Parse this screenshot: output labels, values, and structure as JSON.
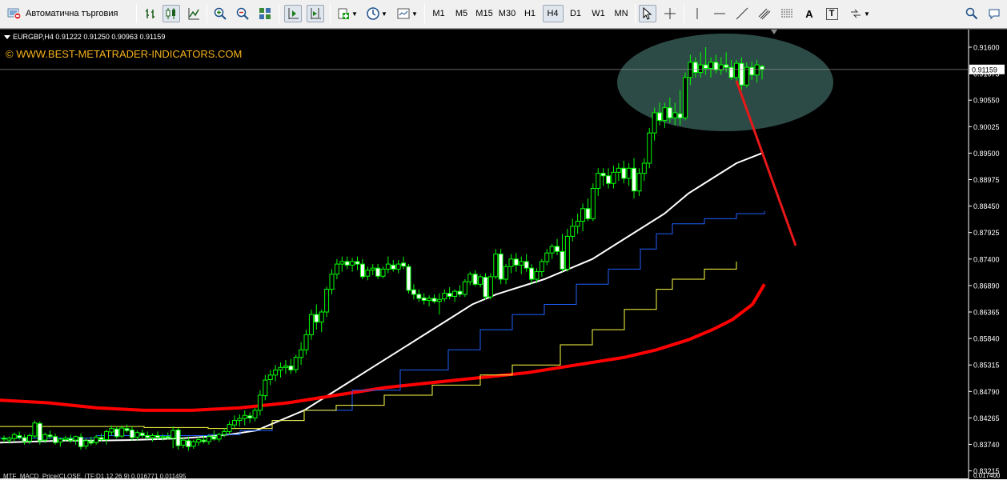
{
  "toolbar": {
    "autotrading_label": "Автоматична търговия",
    "timeframes": [
      "M1",
      "M5",
      "M15",
      "M30",
      "H1",
      "H4",
      "D1",
      "W1",
      "MN"
    ],
    "active_timeframe": "H4",
    "letter_tool": "A",
    "text_tool": "T"
  },
  "chart": {
    "symbol_info": "EURGBP,H4  0.91222 0.91250 0.90963 0.91159",
    "watermark": "© WWW.BEST-METATRADER-INDICATORS.COM",
    "indicator_label": "MTF_MACD_Price(CLOSE, (TF:D1,12,26,9)  0.016771 0.011495",
    "price_labels": [
      "0.91600",
      "0.91075",
      "0.90550",
      "0.90025",
      "0.89500",
      "0.88975",
      "0.88450",
      "0.87925",
      "0.87400",
      "0.86890",
      "0.86365",
      "0.85840",
      "0.85315",
      "0.84790",
      "0.84265",
      "0.83740",
      "0.83215"
    ],
    "current_price": "0.91159",
    "bottom_scale_label": "0.017400"
  },
  "colors": {
    "background": "#000000",
    "bull_candle": "#00ff00",
    "bear_body": "#ffffff",
    "ma_fast": "#ffffff",
    "ma_slow": "#ff0000",
    "envelope_upper": "#1f5fff",
    "envelope_lower": "#ffff40",
    "highlight_ellipse": "#2f4f4a",
    "arrow": "#e81818",
    "watermark": "#f5b21a"
  },
  "chart_data": {
    "type": "candlestick",
    "symbol": "EURGBP",
    "timeframe": "H4",
    "ylim": [
      0.83215,
      0.916
    ],
    "current_price": 0.91159,
    "candles": [
      [
        0.8385,
        0.839,
        0.8376,
        0.8383
      ],
      [
        0.8381,
        0.8388,
        0.8374,
        0.8385
      ],
      [
        0.8384,
        0.8396,
        0.8378,
        0.8392
      ],
      [
        0.839,
        0.8398,
        0.8382,
        0.8386
      ],
      [
        0.8386,
        0.8392,
        0.8372,
        0.8378
      ],
      [
        0.8379,
        0.8394,
        0.8373,
        0.839
      ],
      [
        0.8389,
        0.842,
        0.8385,
        0.8415
      ],
      [
        0.8414,
        0.8418,
        0.8372,
        0.838
      ],
      [
        0.8381,
        0.8396,
        0.8375,
        0.8392
      ],
      [
        0.8391,
        0.84,
        0.8384,
        0.8388
      ],
      [
        0.8388,
        0.8394,
        0.8372,
        0.8376
      ],
      [
        0.8377,
        0.8386,
        0.8368,
        0.8383
      ],
      [
        0.8382,
        0.8389,
        0.8378,
        0.8385
      ],
      [
        0.8384,
        0.8392,
        0.8376,
        0.838
      ],
      [
        0.8381,
        0.839,
        0.8372,
        0.8388
      ],
      [
        0.8387,
        0.8394,
        0.8362,
        0.8368
      ],
      [
        0.8369,
        0.8384,
        0.8363,
        0.838
      ],
      [
        0.8379,
        0.8388,
        0.8371,
        0.8375
      ],
      [
        0.8376,
        0.8391,
        0.8372,
        0.8387
      ],
      [
        0.8386,
        0.8394,
        0.8378,
        0.8382
      ],
      [
        0.8382,
        0.8402,
        0.8372,
        0.8398
      ],
      [
        0.8397,
        0.841,
        0.839,
        0.8404
      ],
      [
        0.8403,
        0.8408,
        0.8384,
        0.8388
      ],
      [
        0.8389,
        0.841,
        0.8385,
        0.8405
      ],
      [
        0.8404,
        0.8412,
        0.8396,
        0.84
      ],
      [
        0.8401,
        0.8408,
        0.838,
        0.8386
      ],
      [
        0.8387,
        0.84,
        0.838,
        0.8396
      ],
      [
        0.8395,
        0.8402,
        0.8385,
        0.839
      ],
      [
        0.839,
        0.8398,
        0.8382,
        0.8386
      ],
      [
        0.8386,
        0.8394,
        0.8378,
        0.839
      ],
      [
        0.839,
        0.8398,
        0.8382,
        0.8386
      ],
      [
        0.8386,
        0.8392,
        0.838,
        0.8388
      ],
      [
        0.8388,
        0.8396,
        0.8382,
        0.8385
      ],
      [
        0.8385,
        0.8408,
        0.8365,
        0.84
      ],
      [
        0.8401,
        0.8405,
        0.8362,
        0.837
      ],
      [
        0.8371,
        0.8386,
        0.8365,
        0.8381
      ],
      [
        0.838,
        0.8388,
        0.836,
        0.8368
      ],
      [
        0.8369,
        0.8382,
        0.8364,
        0.8378
      ],
      [
        0.8377,
        0.8388,
        0.837,
        0.8382
      ],
      [
        0.8381,
        0.839,
        0.8374,
        0.8378
      ],
      [
        0.8378,
        0.8392,
        0.8372,
        0.8388
      ],
      [
        0.8388,
        0.84,
        0.838,
        0.8383
      ],
      [
        0.8383,
        0.8396,
        0.8377,
        0.8392
      ],
      [
        0.8392,
        0.8405,
        0.8387,
        0.8398
      ],
      [
        0.8398,
        0.8418,
        0.8392,
        0.8412
      ],
      [
        0.8411,
        0.843,
        0.8404,
        0.842
      ],
      [
        0.842,
        0.8432,
        0.8408,
        0.8424
      ],
      [
        0.8424,
        0.844,
        0.841,
        0.843
      ],
      [
        0.8429,
        0.8436,
        0.8415,
        0.8425
      ],
      [
        0.8425,
        0.8445,
        0.8418,
        0.844
      ],
      [
        0.844,
        0.848,
        0.843,
        0.847
      ],
      [
        0.8469,
        0.851,
        0.846,
        0.85
      ],
      [
        0.8501,
        0.852,
        0.849,
        0.851
      ],
      [
        0.851,
        0.853,
        0.8498,
        0.852
      ],
      [
        0.852,
        0.8535,
        0.8505,
        0.8525
      ],
      [
        0.8525,
        0.854,
        0.8512,
        0.8528
      ],
      [
        0.8528,
        0.8542,
        0.8512,
        0.852
      ],
      [
        0.8521,
        0.855,
        0.8514,
        0.8545
      ],
      [
        0.8545,
        0.8575,
        0.853,
        0.856
      ],
      [
        0.856,
        0.86,
        0.855,
        0.859
      ],
      [
        0.859,
        0.864,
        0.858,
        0.863
      ],
      [
        0.863,
        0.865,
        0.86,
        0.8615
      ],
      [
        0.8615,
        0.864,
        0.8595,
        0.8635
      ],
      [
        0.8635,
        0.8685,
        0.8625,
        0.868
      ],
      [
        0.868,
        0.872,
        0.867,
        0.871
      ],
      [
        0.871,
        0.874,
        0.87,
        0.873
      ],
      [
        0.873,
        0.8745,
        0.8715,
        0.8735
      ],
      [
        0.8735,
        0.8745,
        0.872,
        0.8728
      ],
      [
        0.8728,
        0.8742,
        0.8715,
        0.8735
      ],
      [
        0.8735,
        0.8745,
        0.8718,
        0.873
      ],
      [
        0.873,
        0.874,
        0.87,
        0.8705
      ],
      [
        0.8706,
        0.8725,
        0.8698,
        0.8718
      ],
      [
        0.8718,
        0.873,
        0.8708,
        0.8722
      ],
      [
        0.8722,
        0.873,
        0.87,
        0.8706
      ],
      [
        0.8706,
        0.8725,
        0.8702,
        0.872
      ],
      [
        0.872,
        0.8745,
        0.8712,
        0.873
      ],
      [
        0.8728,
        0.8738,
        0.8715,
        0.872
      ],
      [
        0.872,
        0.8738,
        0.8712,
        0.873
      ],
      [
        0.8732,
        0.8745,
        0.872,
        0.8726
      ],
      [
        0.8725,
        0.873,
        0.8672,
        0.8678
      ],
      [
        0.8679,
        0.869,
        0.866,
        0.867
      ],
      [
        0.867,
        0.868,
        0.8655,
        0.8662
      ],
      [
        0.8663,
        0.8672,
        0.865,
        0.8658
      ],
      [
        0.8658,
        0.8668,
        0.8646,
        0.8662
      ],
      [
        0.8662,
        0.867,
        0.8652,
        0.8656
      ],
      [
        0.8656,
        0.8672,
        0.863,
        0.866
      ],
      [
        0.8661,
        0.868,
        0.8655,
        0.8672
      ],
      [
        0.8672,
        0.8684,
        0.866,
        0.8666
      ],
      [
        0.8666,
        0.868,
        0.8655,
        0.8676
      ],
      [
        0.8676,
        0.8688,
        0.8665,
        0.867
      ],
      [
        0.867,
        0.87,
        0.8665,
        0.8695
      ],
      [
        0.8695,
        0.8715,
        0.8688,
        0.871
      ],
      [
        0.871,
        0.8718,
        0.8686,
        0.869
      ],
      [
        0.869,
        0.871,
        0.8684,
        0.8705
      ],
      [
        0.8704,
        0.8712,
        0.866,
        0.8665
      ],
      [
        0.8665,
        0.8712,
        0.866,
        0.8705
      ],
      [
        0.8705,
        0.876,
        0.87,
        0.875
      ],
      [
        0.875,
        0.876,
        0.869,
        0.87
      ],
      [
        0.87,
        0.873,
        0.869,
        0.8725
      ],
      [
        0.8725,
        0.875,
        0.8712,
        0.874
      ],
      [
        0.874,
        0.8752,
        0.8715,
        0.8728
      ],
      [
        0.8728,
        0.8745,
        0.871,
        0.8735
      ],
      [
        0.8735,
        0.875,
        0.8715,
        0.8722
      ],
      [
        0.8722,
        0.873,
        0.869,
        0.87
      ],
      [
        0.87,
        0.8722,
        0.8692,
        0.8715
      ],
      [
        0.8715,
        0.874,
        0.8705,
        0.8735
      ],
      [
        0.8735,
        0.876,
        0.8728,
        0.8752
      ],
      [
        0.8752,
        0.877,
        0.874,
        0.8765
      ],
      [
        0.8765,
        0.878,
        0.8748,
        0.8755
      ],
      [
        0.8755,
        0.879,
        0.8715,
        0.872
      ],
      [
        0.872,
        0.88,
        0.8715,
        0.8785
      ],
      [
        0.8785,
        0.882,
        0.8775,
        0.8805
      ],
      [
        0.8805,
        0.883,
        0.879,
        0.8815
      ],
      [
        0.8815,
        0.885,
        0.8795,
        0.884
      ],
      [
        0.884,
        0.886,
        0.8815,
        0.882
      ],
      [
        0.882,
        0.889,
        0.8815,
        0.888
      ],
      [
        0.888,
        0.892,
        0.8865,
        0.891
      ],
      [
        0.891,
        0.892,
        0.8885,
        0.8905
      ],
      [
        0.8905,
        0.892,
        0.888,
        0.889
      ],
      [
        0.889,
        0.8925,
        0.888,
        0.8912
      ],
      [
        0.8912,
        0.893,
        0.8895,
        0.892
      ],
      [
        0.892,
        0.8935,
        0.889,
        0.89
      ],
      [
        0.89,
        0.893,
        0.8885,
        0.892
      ],
      [
        0.892,
        0.894,
        0.886,
        0.8875
      ],
      [
        0.8875,
        0.892,
        0.8865,
        0.891
      ],
      [
        0.891,
        0.894,
        0.8895,
        0.893
      ],
      [
        0.893,
        0.9,
        0.892,
        0.899
      ],
      [
        0.899,
        0.904,
        0.8975,
        0.903
      ],
      [
        0.903,
        0.905,
        0.9005,
        0.9015
      ],
      [
        0.9015,
        0.905,
        0.9,
        0.904
      ],
      [
        0.904,
        0.906,
        0.901,
        0.902
      ],
      [
        0.902,
        0.905,
        0.9005,
        0.903
      ],
      [
        0.9028,
        0.9075,
        0.9005,
        0.902
      ],
      [
        0.902,
        0.911,
        0.9015,
        0.91
      ],
      [
        0.91,
        0.9145,
        0.9085,
        0.913
      ],
      [
        0.913,
        0.914,
        0.91,
        0.911
      ],
      [
        0.911,
        0.915,
        0.91,
        0.9125
      ],
      [
        0.9125,
        0.916,
        0.9105,
        0.9118
      ],
      [
        0.9118,
        0.914,
        0.91,
        0.913
      ],
      [
        0.913,
        0.9145,
        0.9108,
        0.9115
      ],
      [
        0.9115,
        0.914,
        0.9105,
        0.9125
      ],
      [
        0.9125,
        0.915,
        0.911,
        0.912
      ],
      [
        0.912,
        0.9135,
        0.9095,
        0.91
      ],
      [
        0.91,
        0.9135,
        0.909,
        0.9128
      ],
      [
        0.9128,
        0.914,
        0.9075,
        0.9085
      ],
      [
        0.9085,
        0.913,
        0.908,
        0.912
      ],
      [
        0.912,
        0.9132,
        0.9095,
        0.9105
      ],
      [
        0.9105,
        0.9135,
        0.909,
        0.9125
      ],
      [
        0.9122,
        0.9125,
        0.9096,
        0.9116
      ]
    ],
    "series": [
      {
        "values": [
          0.8376,
          0.8378,
          0.838,
          0.838,
          0.8381,
          0.8383,
          0.8385,
          0.8388,
          0.8393,
          0.84,
          0.842,
          0.844,
          0.847,
          0.85,
          0.853,
          0.856,
          0.859,
          0.862,
          0.865,
          0.867,
          0.8685,
          0.87,
          0.872,
          0.874,
          0.877,
          0.88,
          0.883,
          0.887,
          0.89,
          0.893,
          0.895
        ]
      },
      {
        "values": [
          0.846,
          0.8455,
          0.8445,
          0.844,
          0.844,
          0.8445,
          0.8455,
          0.847,
          0.8485,
          0.8495,
          0.8505,
          0.8515,
          0.853,
          0.8545,
          0.856,
          0.858,
          0.86,
          0.862,
          0.865,
          0.869
        ]
      },
      {
        "values": [
          0.8385,
          0.839,
          0.839,
          0.8392,
          0.84,
          0.842,
          0.844,
          0.848,
          0.852,
          0.856,
          0.86,
          0.863,
          0.865,
          0.869,
          0.872,
          0.876,
          0.879,
          0.881,
          0.882,
          0.883,
          0.8835
        ]
      },
      {
        "values": [
          0.8408,
          0.8406,
          0.8404,
          0.8404,
          0.842,
          0.844,
          0.845,
          0.847,
          0.849,
          0.851,
          0.853,
          0.857,
          0.86,
          0.864,
          0.868,
          0.87,
          0.872,
          0.8735
        ]
      }
    ]
  }
}
